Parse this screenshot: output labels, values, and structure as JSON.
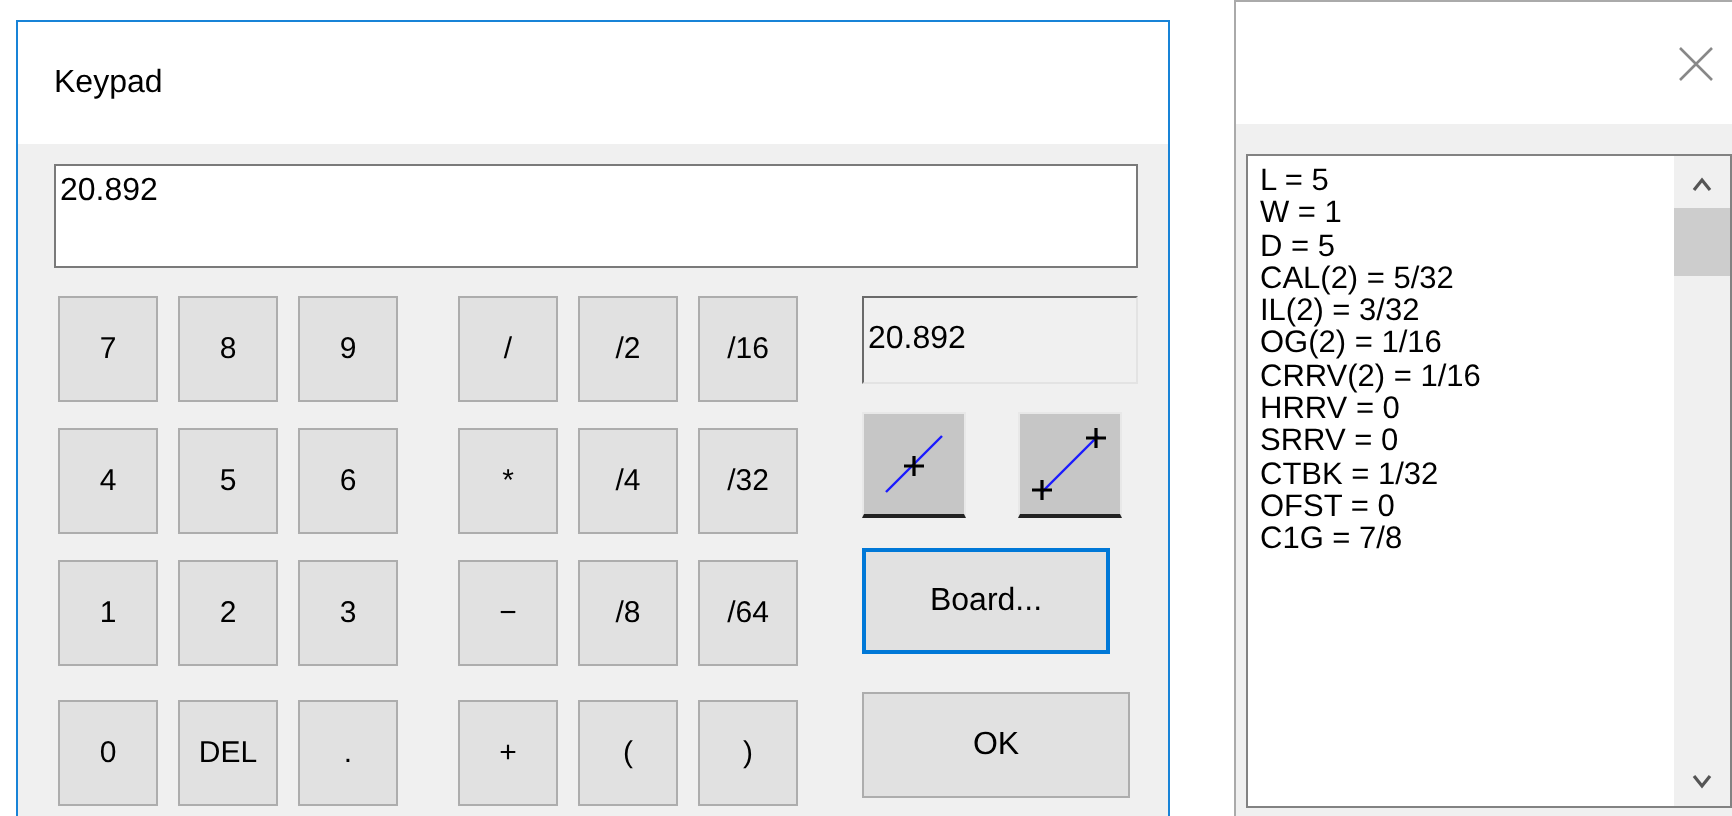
{
  "keypad_window": {
    "title": "Keypad",
    "display": "20.892",
    "keys": [
      [
        "7",
        "8",
        "9",
        "/",
        "/2",
        "/16"
      ],
      [
        "4",
        "5",
        "6",
        "*",
        "/4",
        "/32"
      ],
      [
        "1",
        "2",
        "3",
        "−",
        "/8",
        "/64"
      ],
      [
        "0",
        "DEL",
        ".",
        "+",
        "(",
        ")"
      ]
    ],
    "readout": "20.892",
    "tool_buttons": [
      {
        "kind": "midpoint"
      },
      {
        "kind": "endpoints"
      }
    ],
    "board_button": {
      "label": "Board...",
      "focused": true
    },
    "ok_button": {
      "label": "OK",
      "focused": false
    }
  },
  "list_window": {
    "lines": [
      "L = 5",
      "W = 1",
      "D = 5",
      "CAL(2) = 5/32",
      "IL(2) = 3/32",
      "OG(2) = 1/16",
      "CRRV(2) = 1/16",
      "HRRV = 0",
      "SRRV = 0",
      "CTBK = 1/32",
      "OFST = 0",
      "C1G = 7/8"
    ]
  }
}
